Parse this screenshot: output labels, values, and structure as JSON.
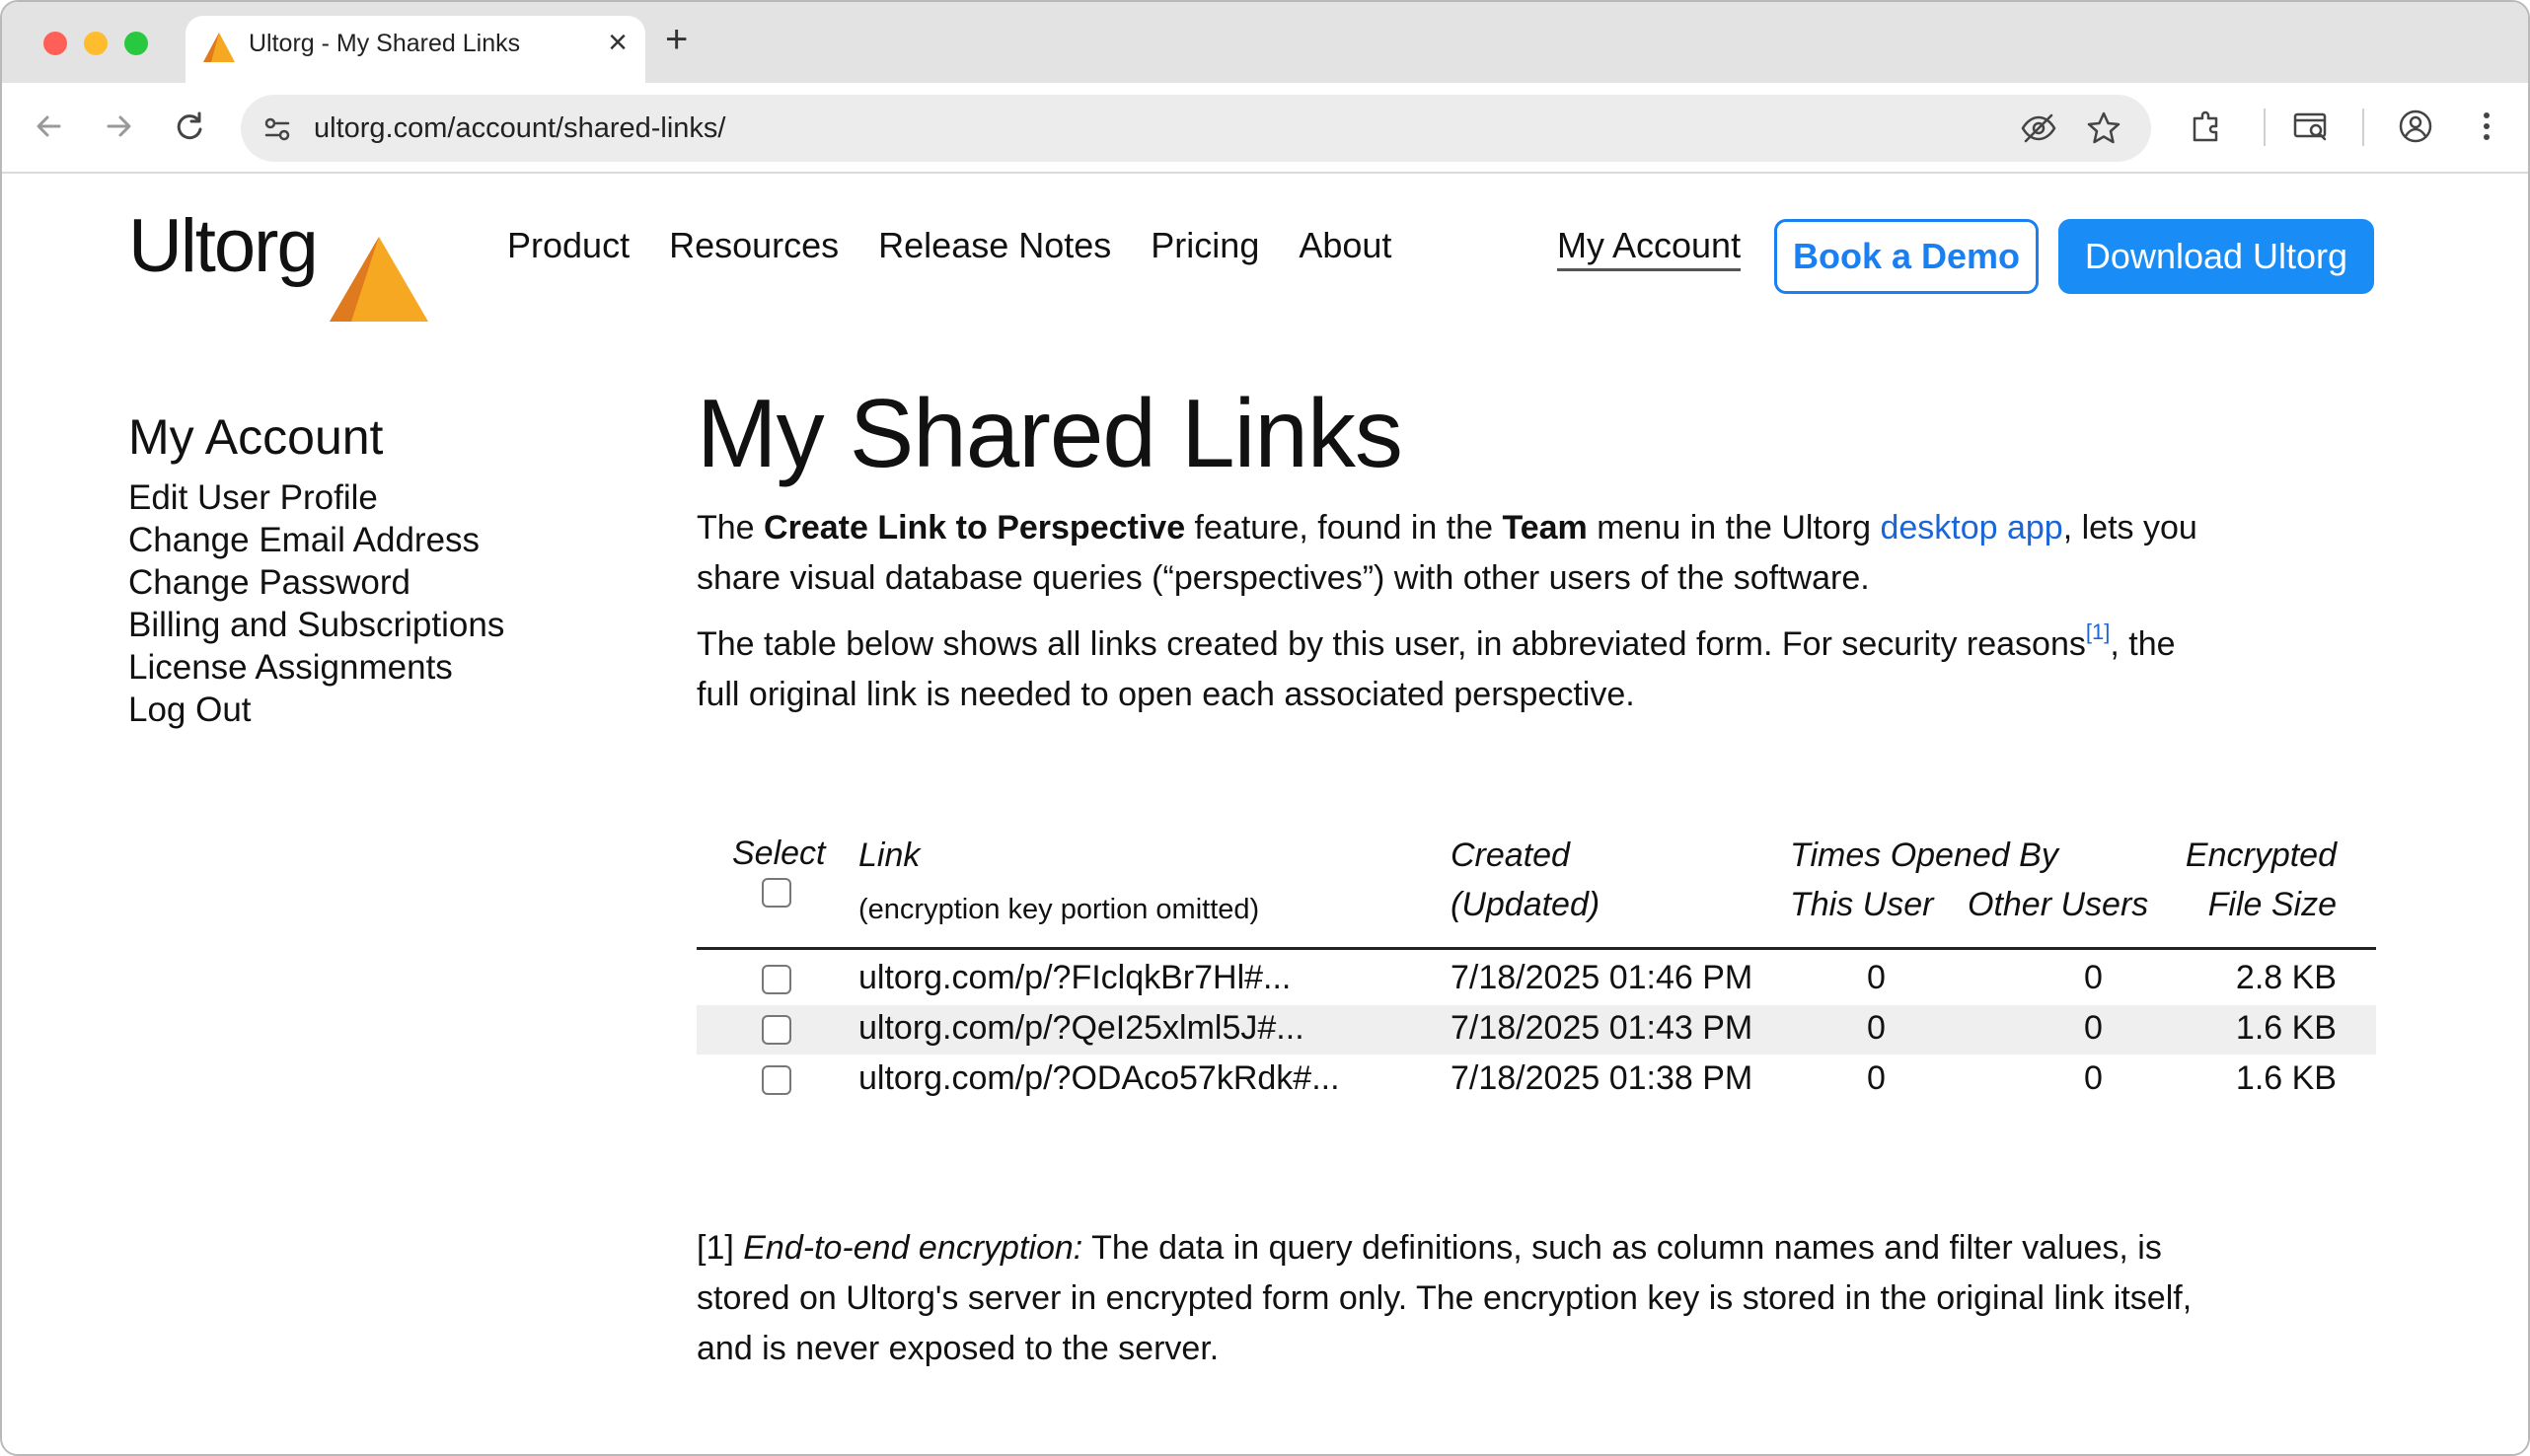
{
  "browser": {
    "tab_title": "Ultorg - My Shared Links",
    "url": "ultorg.com/account/shared-links/"
  },
  "header": {
    "logo_text": "Ultorg",
    "nav": [
      "Product",
      "Resources",
      "Release Notes",
      "Pricing",
      "About"
    ],
    "my_account": "My Account",
    "book_demo": "Book a Demo",
    "download": "Download Ultorg",
    "colors": {
      "accent_blue": "#1a8cf5",
      "logo_orange": "#f7a823",
      "logo_dark_orange": "#e07a1f"
    }
  },
  "sidebar": {
    "title": "My Account",
    "items": [
      "Edit User Profile",
      "Change Email Address",
      "Change Password",
      "Billing and Subscriptions",
      "License Assignments",
      "Log Out"
    ]
  },
  "main": {
    "title": "My Shared Links",
    "p1": {
      "t1": "The ",
      "b1": "Create Link to Perspective",
      "t2": " feature, found in the ",
      "b2": "Team",
      "t3": " menu in the Ultorg ",
      "link": "desktop app",
      "t4": ", lets you share visual database queries (“perspectives”) with other users of the software."
    },
    "p2": {
      "t1": "The table below shows all links created by this user, in abbreviated form. For security reasons",
      "fn": "[1]",
      "t2": ", the full original link is needed to open each associated perspective."
    }
  },
  "table": {
    "headers": {
      "select": "Select",
      "link": "Link",
      "link_sub": "(encryption key portion omitted)",
      "created": "Created",
      "updated": "(Updated)",
      "times_opened_by": "Times Opened By",
      "this_user": "This User",
      "other_users": "Other Users",
      "encrypted": "Encrypted",
      "file_size": "File Size"
    },
    "rows": [
      {
        "link": "ultorg.com/p/?FIclqkBr7Hl#...",
        "created": "7/18/2025 01:46 PM",
        "this_user": "0",
        "other_users": "0",
        "size": "2.8 KB"
      },
      {
        "link": "ultorg.com/p/?QeI25xlml5J#...",
        "created": "7/18/2025 01:43 PM",
        "this_user": "0",
        "other_users": "0",
        "size": "1.6 KB"
      },
      {
        "link": "ultorg.com/p/?ODAco57kRdk#...",
        "created": "7/18/2025 01:38 PM",
        "this_user": "0",
        "other_users": "0",
        "size": "1.6 KB"
      }
    ]
  },
  "footnote": {
    "label": "[1] ",
    "title": "End-to-end encryption:",
    "text": " The data in query definitions, such as column names and filter values, is stored on Ultorg's server in encrypted form only. The encryption key is stored in the original link itself, and is never exposed to the server."
  }
}
